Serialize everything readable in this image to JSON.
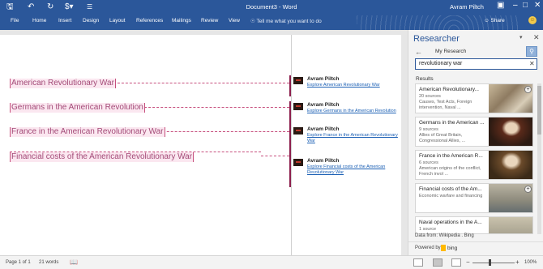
{
  "app": {
    "title": "Document3 - Word",
    "user": "Avram Piltch"
  },
  "ribbon": {
    "tabs": [
      "File",
      "Home",
      "Insert",
      "Design",
      "Layout",
      "References",
      "Mailings",
      "Review",
      "View"
    ],
    "tell_me": "Tell me what you want to do",
    "share": "Share",
    "accent": "#2b579a"
  },
  "document": {
    "paragraphs": [
      "American Revolutionary War",
      "Germans in the American Revolution",
      "France in the American Revolutionary War",
      "Financial costs of the American Revolutionary War"
    ],
    "comments": [
      {
        "author": "Avram Piltch",
        "link": "Explore American Revolutionary War"
      },
      {
        "author": "Avram Piltch",
        "link": "Explore Germans in the American Revolution"
      },
      {
        "author": "Avram Piltch",
        "link": "Explore France in the American Revolutionary War"
      },
      {
        "author": "Avram Piltch",
        "link": "Explore Financial costs of the American Revolutionary War"
      }
    ],
    "comment_color": "#c7507e"
  },
  "researcher": {
    "title": "Researcher",
    "nav_label": "My Research",
    "query": "revolutionary war",
    "results_label": "Results",
    "results": [
      {
        "title": "American Revolutionary...",
        "sources": "20 sources",
        "snippet": "Causes, Test Acts, Foreign intervention, Naval ..."
      },
      {
        "title": "Germans in the American ...",
        "sources": "9 sources",
        "snippet": "Allies of Great Britain, Congressional Allies, ..."
      },
      {
        "title": "France in the American R...",
        "sources": "6 sources",
        "snippet": "American origins of the conflict, French invol ..."
      },
      {
        "title": "Financial costs of the Am...",
        "sources": "",
        "snippet": "Economic warfare and financing"
      },
      {
        "title": "Naval operations in the A...",
        "sources": "1 source",
        "snippet": ""
      }
    ],
    "data_from": "Data from: Wikipedia . Bing",
    "powered_by": "Powered by",
    "powered_brand": "bing"
  },
  "status": {
    "page": "Page 1 of 1",
    "words": "21 words",
    "zoom": "100%"
  }
}
